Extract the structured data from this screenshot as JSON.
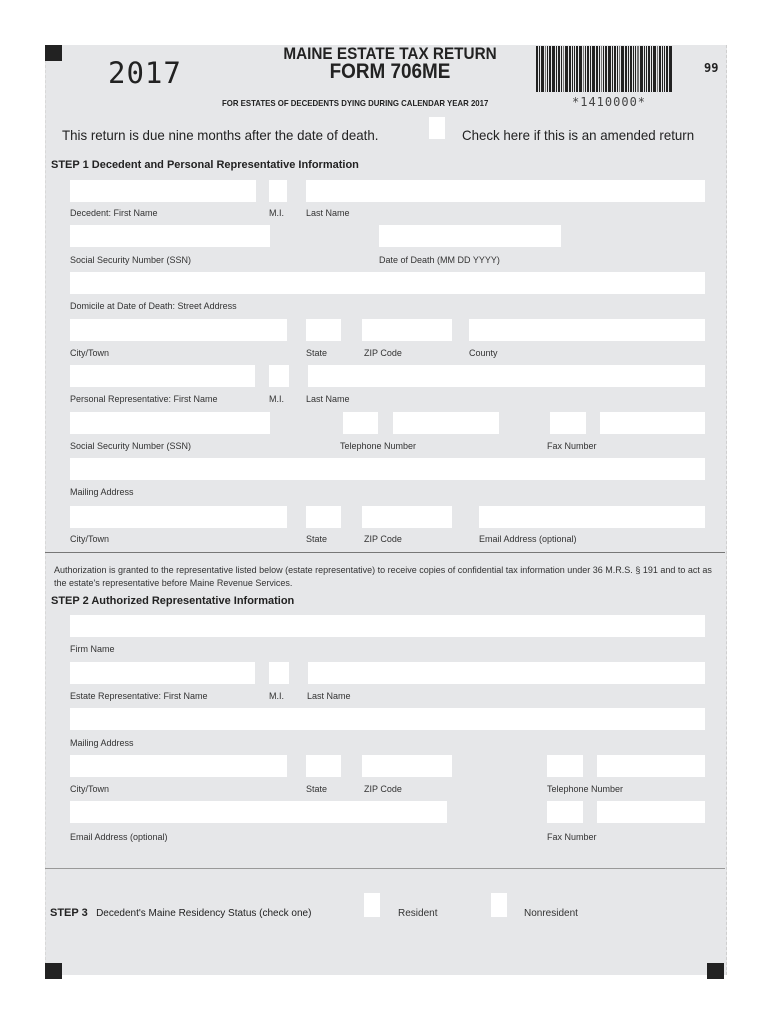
{
  "header": {
    "year": "2017",
    "title_line1": "MAINE ESTATE TAX RETURN",
    "title_line2": "FORM 706ME",
    "subtitle": "FOR ESTATES OF DECEDENTS DYING DURING CALENDAR YEAR 2017",
    "barcode_number": "*1410000*",
    "page_code": "99",
    "due_notice": "This return is due nine months after the date of death.",
    "amended_label": "Check here if this is an amended return"
  },
  "step1": {
    "title": "STEP 1 Decedent and Personal Representative Information",
    "labels": {
      "decedent_first": "Decedent:  First Name",
      "decedent_mi": "M.I.",
      "decedent_last": "Last Name",
      "decedent_ssn": "Social Security Number (SSN)",
      "date_of_death": "Date of Death (MM DD YYYY)",
      "domicile": "Domicile at Date of Death: Street Address",
      "city": "City/Town",
      "state": "State",
      "zip": "ZIP Code",
      "county": "County",
      "rep_first": "Personal Representative:  First Name",
      "rep_mi": "M.I.",
      "rep_last": "Last Name",
      "rep_ssn": "Social Security Number (SSN)",
      "rep_phone": "Telephone Number",
      "rep_fax": "Fax Number",
      "rep_mailing": "Mailing Address",
      "rep_city": "City/Town",
      "rep_state": "State",
      "rep_zip": "ZIP Code",
      "rep_email": "Email Address (optional)"
    }
  },
  "authorization": "Authorization is granted to the representative listed below (estate representative) to receive copies of confidential tax information under 36 M.R.S. § 191 and to act as the estate's representative before Maine Revenue Services.",
  "step2": {
    "title": "STEP 2 Authorized Representative Information",
    "labels": {
      "firm": "Firm Name",
      "first": "Estate Representative: First Name",
      "mi": "M.I.",
      "last": "Last Name",
      "mailing": "Mailing Address",
      "city": "City/Town",
      "state": "State",
      "zip": "ZIP Code",
      "phone": "Telephone Number",
      "email": "Email Address (optional)",
      "fax": "Fax Number"
    }
  },
  "step3": {
    "step_label": "STEP 3",
    "question": "Decedent's Maine Residency Status (check one)",
    "option_resident": "Resident",
    "option_nonresident": "Nonresident"
  }
}
